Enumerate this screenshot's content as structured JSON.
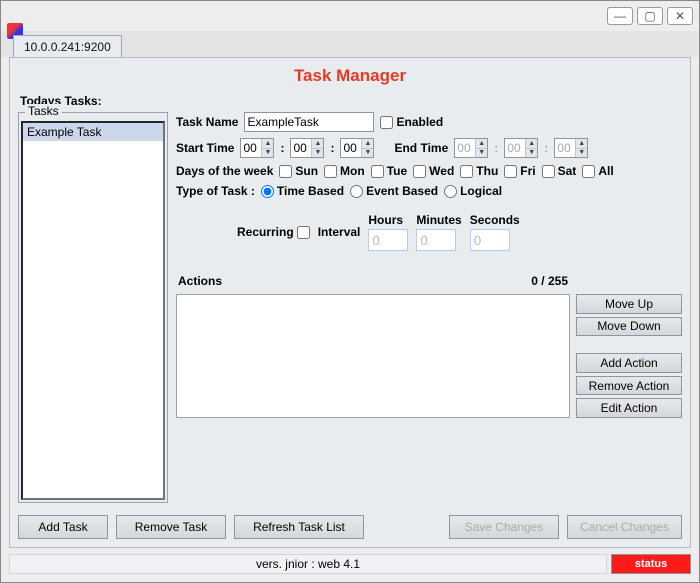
{
  "window": {
    "tab_label": "10.0.0.241:9200",
    "titlebar": {
      "min": "—",
      "max": "▢",
      "close": "✕"
    }
  },
  "header": {
    "page_title": "Task Manager",
    "todays_tasks_label": "Todays Tasks:",
    "tasks_legend": "Tasks"
  },
  "tasks": {
    "items": [
      "Example Task"
    ],
    "bottom": {
      "add": "Add Task",
      "remove": "Remove Task",
      "refresh": "Refresh Task List",
      "save": "Save Changes",
      "cancel": "Cancel Changes"
    }
  },
  "form": {
    "name_label": "Task Name",
    "name_value": "ExampleTask",
    "enabled_label": "Enabled",
    "start_label": "Start Time",
    "start": {
      "h": "00",
      "m": "00",
      "s": "00"
    },
    "end_label": "End Time",
    "end": {
      "h": "00",
      "m": "00",
      "s": "00"
    },
    "days_label": "Days of the week",
    "days": [
      "Sun",
      "Mon",
      "Tue",
      "Wed",
      "Thu",
      "Fri",
      "Sat",
      "All"
    ],
    "type_label": "Type of Task :",
    "types": {
      "time": "Time Based",
      "event": "Event Based",
      "logical": "Logical"
    },
    "recurring_label": "Recurring",
    "interval_label": "Interval",
    "interval_headers": {
      "h": "Hours",
      "m": "Minutes",
      "s": "Seconds"
    },
    "interval_values": {
      "h": "0",
      "m": "0",
      "s": "0"
    }
  },
  "actions": {
    "label": "Actions",
    "counter": "0 / 255",
    "buttons": {
      "up": "Move Up",
      "down": "Move Down",
      "add": "Add Action",
      "remove": "Remove Action",
      "edit": "Edit Action"
    }
  },
  "status": {
    "text": "vers. jnior  : web 4.1",
    "led": "status"
  }
}
